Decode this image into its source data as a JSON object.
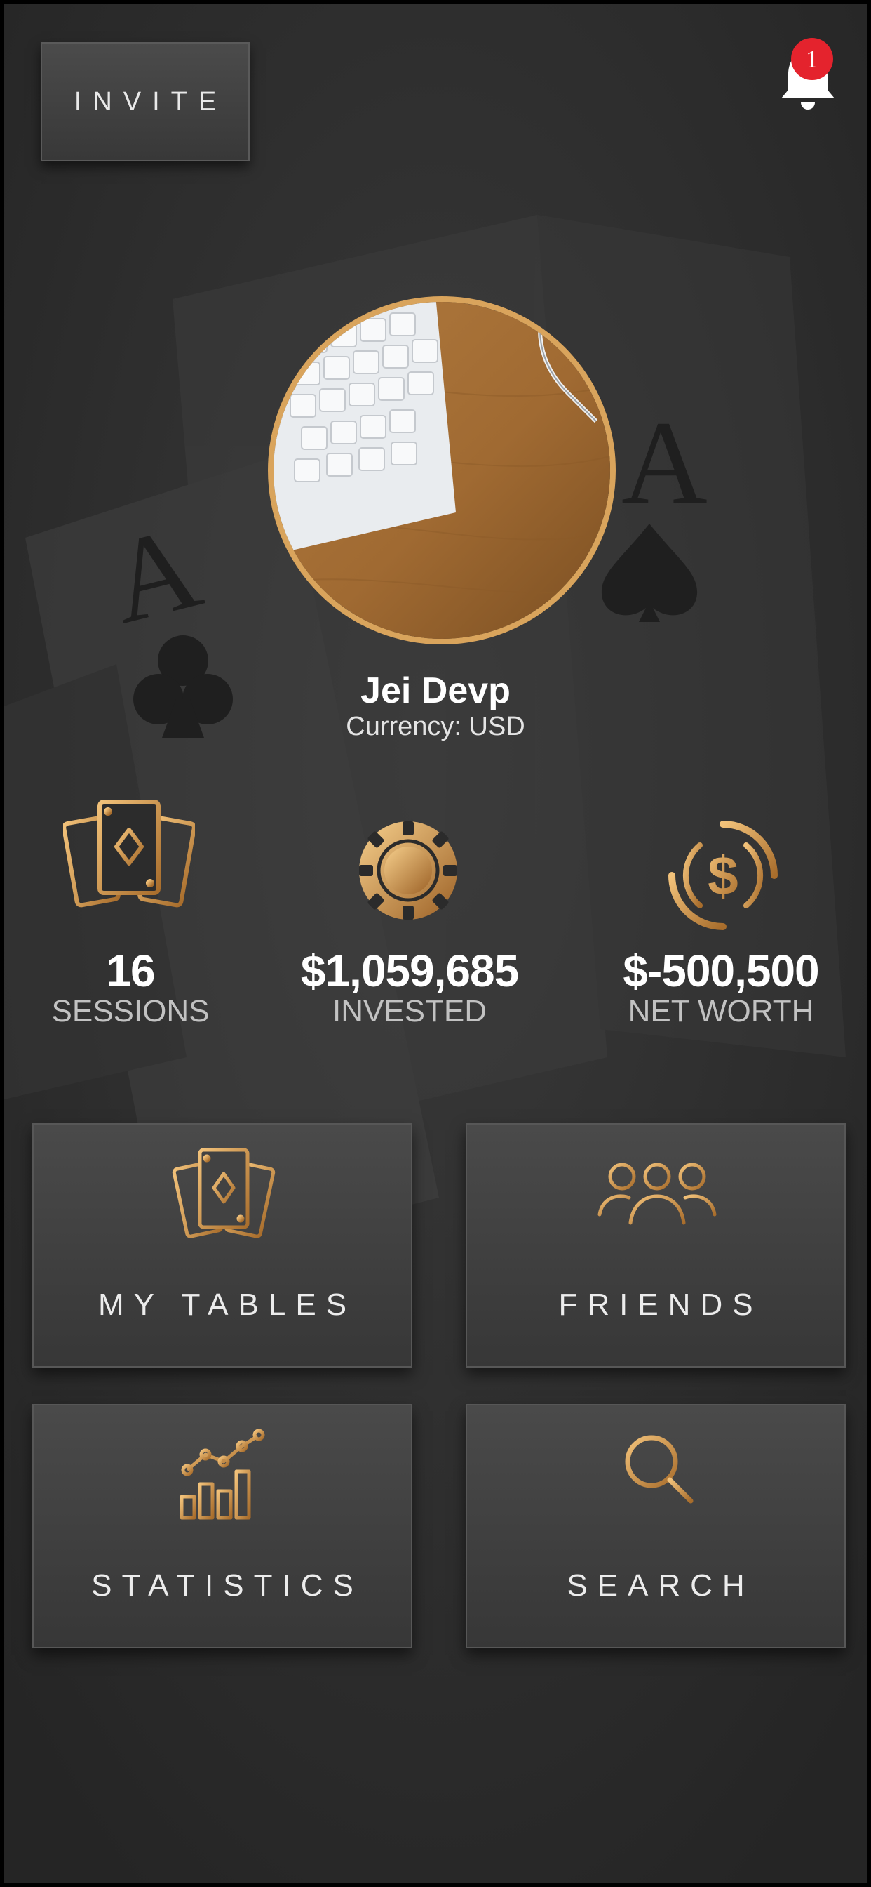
{
  "header": {
    "invite_label": "INVITE",
    "notification_count": "1"
  },
  "profile": {
    "name": "Jei Devp",
    "currency": "Currency: USD"
  },
  "stats": [
    {
      "value": "16",
      "label": "SESSIONS",
      "icon": "playing-cards-icon"
    },
    {
      "value": "$1,059,685",
      "label": "INVESTED",
      "icon": "poker-chip-icon"
    },
    {
      "value": "$-500,500",
      "label": "NET WORTH",
      "icon": "dollar-coin-icon"
    }
  ],
  "menu": [
    {
      "label": "MY TABLES",
      "icon": "playing-cards-icon"
    },
    {
      "label": "FRIENDS",
      "icon": "friends-icon"
    },
    {
      "label": "STATISTICS",
      "icon": "statistics-chart-icon"
    },
    {
      "label": "SEARCH",
      "icon": "search-icon"
    }
  ],
  "colors": {
    "accent_gold": "#d9a45c",
    "background": "#2b2b2b",
    "tile": "#424242",
    "badge": "#e4232d"
  }
}
